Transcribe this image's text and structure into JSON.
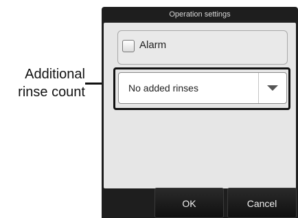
{
  "callout": {
    "line1": "Additional",
    "line2": "rinse count"
  },
  "dialog": {
    "title": "Operation settings",
    "alarm": {
      "label": "Alarm",
      "checked": false
    },
    "rinse_select": {
      "value": "No added rinses"
    },
    "buttons": {
      "ok": "OK",
      "cancel": "Cancel"
    }
  }
}
